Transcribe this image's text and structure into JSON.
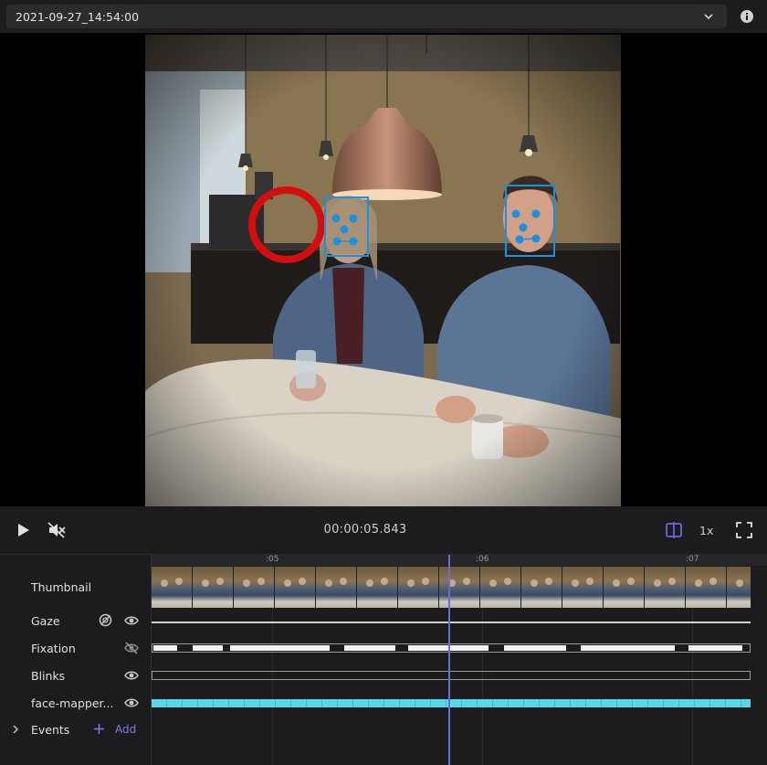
{
  "header": {
    "recording_name": "2021-09-27_14:54:00",
    "dropdown_icon": "chevron-down-icon",
    "info_icon": "info-icon"
  },
  "player": {
    "timecode": "00:00:05.843",
    "speed": "1x",
    "icons": [
      "play-icon",
      "mute-icon",
      "split-view-icon",
      "fullscreen-icon"
    ]
  },
  "timeline": {
    "ticks": [
      ":05",
      ":06",
      ":07"
    ],
    "rows": [
      {
        "label": "Thumbnail"
      },
      {
        "label": "Gaze",
        "icons": [
          "gaze-offset-icon",
          "eye-icon"
        ]
      },
      {
        "label": "Fixation",
        "icons": [
          "eye-off-icon"
        ]
      },
      {
        "label": "Blinks",
        "icons": [
          "eye-icon"
        ]
      },
      {
        "label": "face-mapper...",
        "icons": [
          "eye-icon"
        ]
      }
    ],
    "events": {
      "label": "Events",
      "add_label": "Add"
    }
  },
  "colors": {
    "accent": "#6b6bd6",
    "face_track": "#56d9e8",
    "gaze_circle": "#d40e0e",
    "face_box": "#1b8fe0"
  }
}
